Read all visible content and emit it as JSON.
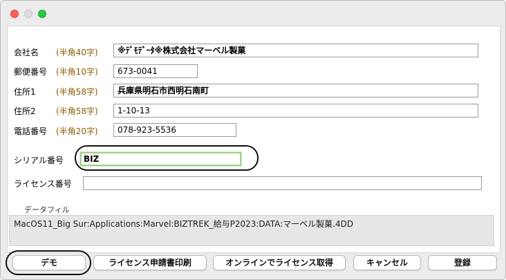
{
  "window": {
    "controls": {
      "close": "close-icon",
      "minimize": "minimize-icon",
      "zoom": "zoom-icon"
    }
  },
  "form": {
    "company": {
      "label": "会社名",
      "hint": "(半角40字)",
      "value": "※ﾃﾞﾓﾃﾞｰﾀ※株式会社マーベル製菓"
    },
    "postal": {
      "label": "郵便番号",
      "hint": "(半角10字)",
      "value": "673-0041"
    },
    "address1": {
      "label": "住所1",
      "hint": "(半角58字)",
      "value": "兵庫県明石市西明石南町"
    },
    "address2": {
      "label": "住所2",
      "hint": "(半角58字)",
      "value": "1-10-13"
    },
    "phone": {
      "label": "電話番号",
      "hint": "(半角20字)",
      "value": "078-923-5536"
    },
    "serial": {
      "label": "シリアル番号",
      "value": "BIZ"
    },
    "license": {
      "label": "ライセンス番号",
      "value": ""
    }
  },
  "datafile": {
    "label": "データフィル",
    "path": "MacOS11_Big Sur:Applications:Marvel:BIZTREK_給与P2023:DATA:マーベル製菓.4DD"
  },
  "buttons": {
    "demo": "デモ",
    "print": "ライセンス申請書印刷",
    "online": "オンラインでライセンス取得",
    "cancel": "キャンセル",
    "register": "登録"
  }
}
